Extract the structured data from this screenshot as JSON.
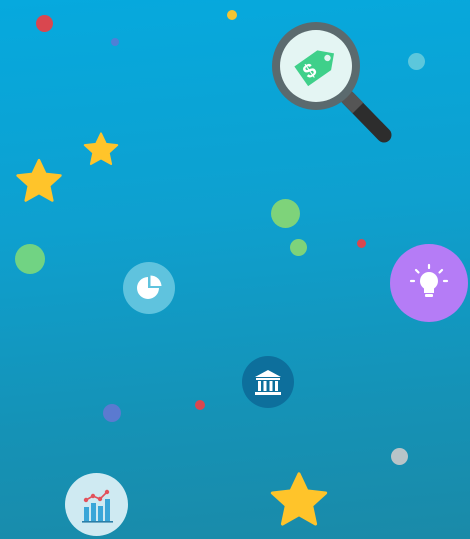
{
  "scene": {
    "colors": {
      "bg_top": "#06a9de",
      "bg_bottom": "#1a8aa8",
      "star": "#ffc42a",
      "lightbulb_badge": "#b57cf6",
      "pie_badge": "#5fc3de",
      "bank_badge": "#0d6f9c",
      "chart_badge": "#cfeaf2",
      "dollar_tag": "#3fd08a"
    },
    "icons": [
      "magnifier-dollar-tag-icon",
      "lightbulb-icon",
      "pie-chart-icon",
      "bank-icon",
      "bar-chart-icon",
      "star-icon"
    ]
  }
}
